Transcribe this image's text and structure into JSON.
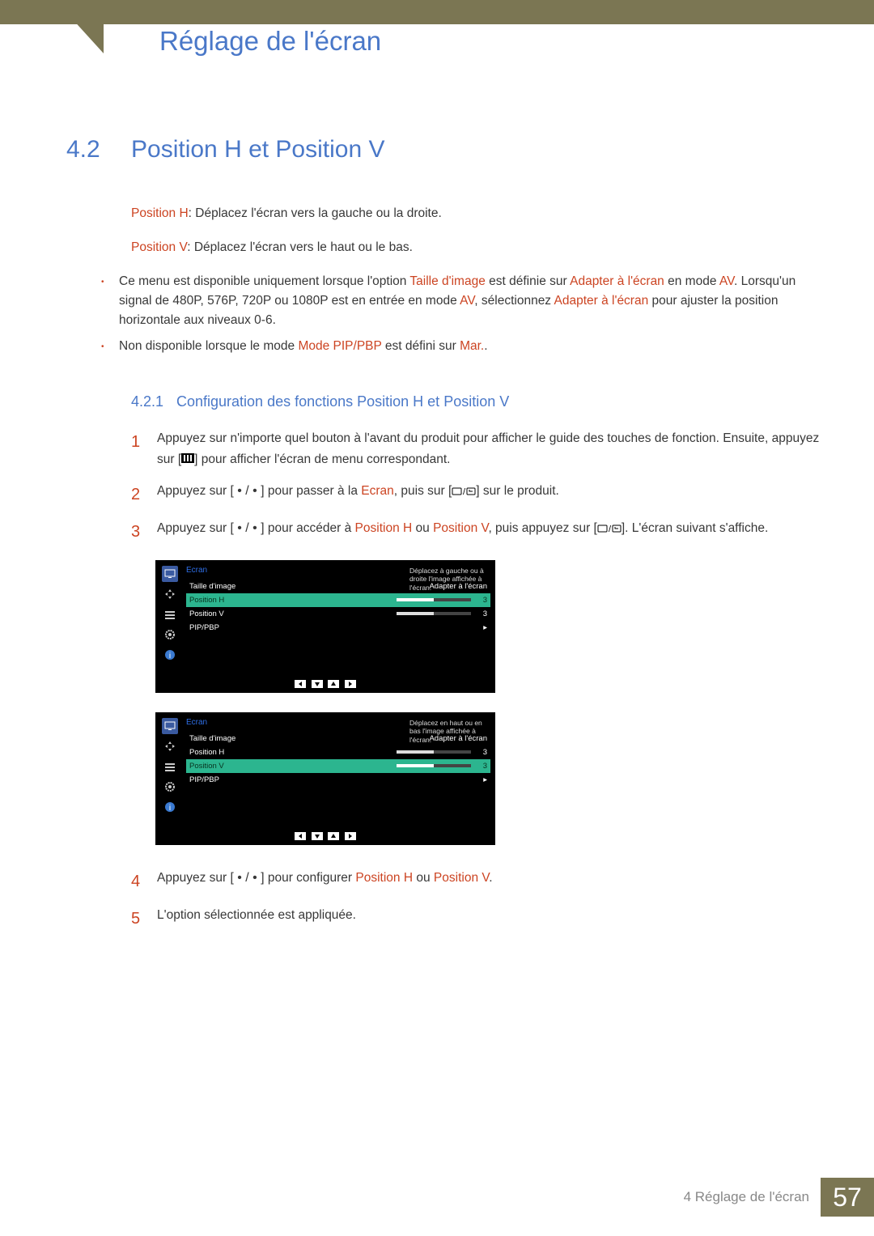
{
  "chapter": {
    "title": "Réglage de l'écran"
  },
  "section": {
    "num": "4.2",
    "title": "Position H et Position V",
    "posH_label": "Position H",
    "posH_desc": ": Déplacez l'écran vers la gauche ou la droite.",
    "posV_label": "Position V",
    "posV_desc": ": Déplacez l'écran vers le haut ou le bas."
  },
  "note": {
    "b1_pre": "Ce menu est disponible uniquement lorsque l'option ",
    "b1_tdi": "Taille d'image",
    "b1_mid1": " est définie sur ",
    "b1_adapter": "Adapter à l'écran",
    "b1_mid2": " en mode ",
    "b1_av": "AV",
    "b1_mid3": ". Lorsqu'un signal de 480P, 576P, 720P ou 1080P est en entrée en mode ",
    "b1_mid4": ", sélectionnez ",
    "b1_mid5": " pour ajuster la position horizontale aux niveaux 0-6.",
    "b2_pre": "Non disponible lorsque le mode ",
    "b2_mode": "Mode PIP/PBP",
    "b2_mid": " est défini sur ",
    "b2_mar": "Mar.",
    "b2_end": "."
  },
  "subsection": {
    "num": "4.2.1",
    "title": "Configuration des fonctions Position H et Position V"
  },
  "steps": {
    "s1a": "Appuyez sur n'importe quel bouton à l'avant du produit pour afficher le guide des touches de fonction. Ensuite, appuyez sur [",
    "s1b": "] pour afficher l'écran de menu correspondant.",
    "s2a": "Appuyez sur [",
    "s2b": "] pour passer à la ",
    "s2_ecran": "Ecran",
    "s2c": ", puis sur [",
    "s2d": "] sur le produit.",
    "s3a": "Appuyez sur [",
    "s3b": "] pour accéder à ",
    "s3_posh": "Position H",
    "s3_ou": " ou ",
    "s3_posv": "Position V",
    "s3c": ", puis appuyez sur [",
    "s3d": "]. L'écran suivant s'affiche.",
    "s4a": "Appuyez sur [",
    "s4b": "] pour configurer ",
    "s4c": ".",
    "s5": "L'option sélectionnée est appliquée."
  },
  "osd1": {
    "category": "Ecran",
    "r1_label": "Taille d'image",
    "r1_val": "Adapter à l'écran",
    "r2_label": "Position H",
    "r2_val": "3",
    "r3_label": "Position V",
    "r3_val": "3",
    "r4_label": "PIP/PBP",
    "help": "Déplacez à gauche ou à droite l'image affichée à l'écran."
  },
  "osd2": {
    "category": "Ecran",
    "r1_label": "Taille d'image",
    "r1_val": "Adapter à l'écran",
    "r2_label": "Position H",
    "r2_val": "3",
    "r3_label": "Position V",
    "r3_val": "3",
    "r4_label": "PIP/PBP",
    "help": "Déplacez en haut ou en bas l'image affichée à l'écran."
  },
  "footer": {
    "chapter_ref": "4 Réglage de l'écran",
    "page": "57"
  }
}
